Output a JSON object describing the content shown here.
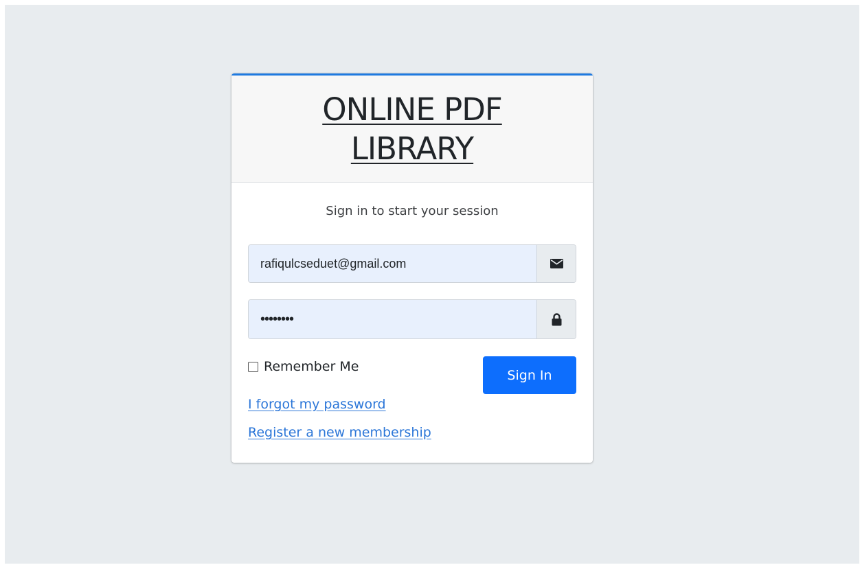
{
  "logo": {
    "title": "ONLINE PDF LIBRARY"
  },
  "login": {
    "message": "Sign in to start your session",
    "email": {
      "value": "rafiqulcseduet@gmail.com",
      "icon": "envelope-icon"
    },
    "password": {
      "value": "••••••••",
      "icon": "lock-icon"
    },
    "remember_label": "Remember Me",
    "remember_checked": false,
    "signin_label": "Sign In",
    "forgot_link": "I forgot my password",
    "register_link": "Register a new membership"
  },
  "colors": {
    "page_background": "#e8ecef",
    "header_accent": "#1f7ae0",
    "primary_button": "#0d6efd",
    "link": "#2b76d8",
    "input_autofill": "#e8f0fd"
  }
}
